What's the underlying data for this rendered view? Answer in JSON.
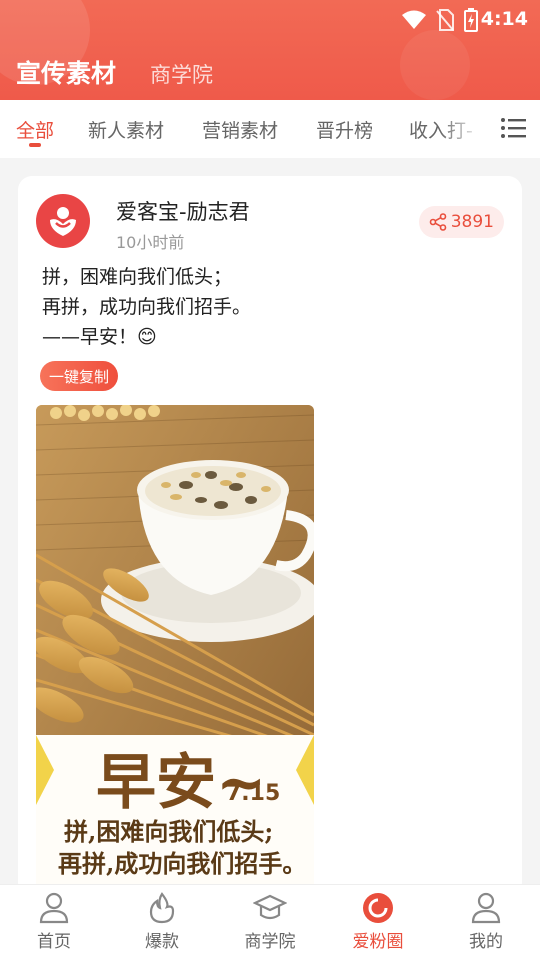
{
  "status_bar": {
    "time": "4:14"
  },
  "header": {
    "title": "宣传素材",
    "subtitle": "商学院"
  },
  "tabs": [
    "全部",
    "新人素材",
    "营销素材",
    "晋升榜",
    "收入打-"
  ],
  "post": {
    "author": "爱客宝-励志君",
    "time": "10小时前",
    "share_count": "3891",
    "lines": [
      "拼，困难向我们低头；",
      "再拼，成功向我们招手。",
      "——早安！😊"
    ],
    "copy_label": "一键复制",
    "image": {
      "headline": "早安~",
      "date": "7.15",
      "line1": "拼,困难向我们低头;",
      "line2": "再拼,成功向我们招手。"
    }
  },
  "nav": [
    "首页",
    "爆款",
    "商学院",
    "爱粉圈",
    "我的"
  ],
  "colors": {
    "accent": "#e94e3c",
    "header": "#ef5a4a"
  }
}
